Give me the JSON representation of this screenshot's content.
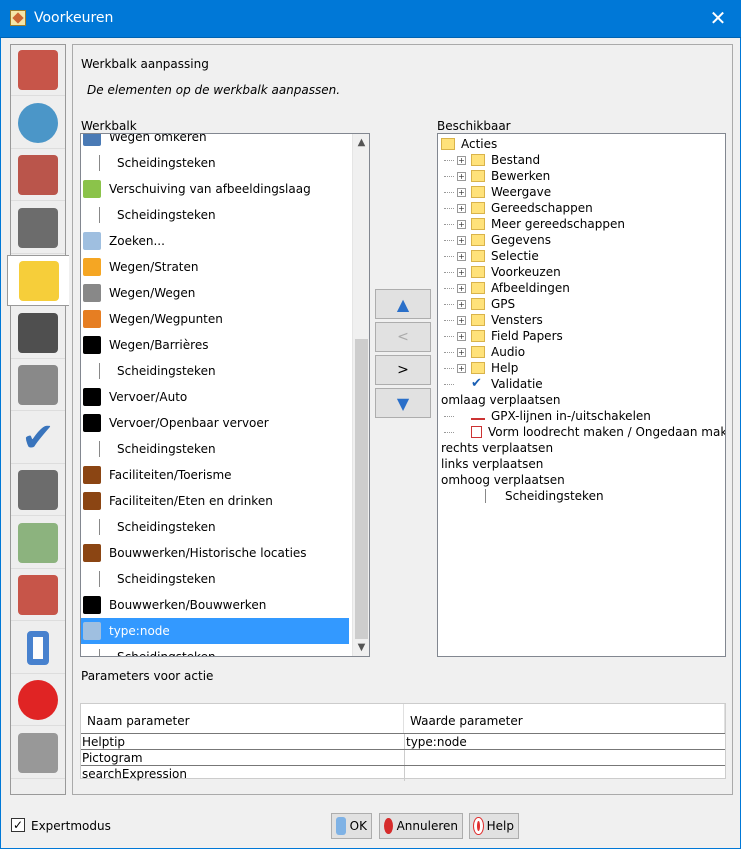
{
  "window": {
    "title": "Voorkeuren"
  },
  "section": {
    "title": "Werkbalk aanpassing",
    "description": "De elementen op de werkbalk aanpassen.",
    "toolbar_label": "Werkbalk",
    "available_label": "Beschikbaar",
    "params_label": "Parameters voor actie"
  },
  "toolbar_items": [
    {
      "label": "Wegen omkeren",
      "icon": "reverse-ways-icon",
      "sep": false
    },
    {
      "label": "Scheidingsteken",
      "icon": "separator-icon",
      "sep": true
    },
    {
      "label": "Verschuiving van afbeeldingslaag",
      "icon": "imagery-offset-icon",
      "sep": false
    },
    {
      "label": "Scheidingsteken",
      "icon": "separator-icon",
      "sep": true
    },
    {
      "label": "Zoeken...",
      "icon": "search-icon",
      "sep": false
    },
    {
      "label": "Wegen/Straten",
      "icon": "street-icon",
      "sep": false
    },
    {
      "label": "Wegen/Wegen",
      "icon": "road-icon",
      "sep": false
    },
    {
      "label": "Wegen/Wegpunten",
      "icon": "waypoints-icon",
      "sep": false
    },
    {
      "label": "Wegen/Barrières",
      "icon": "barrier-hand-icon",
      "sep": false
    },
    {
      "label": "Scheidingsteken",
      "icon": "separator-icon",
      "sep": true
    },
    {
      "label": "Vervoer/Auto",
      "icon": "car-icon",
      "sep": false
    },
    {
      "label": "Vervoer/Openbaar vervoer",
      "icon": "bus-icon",
      "sep": false
    },
    {
      "label": "Scheidingsteken",
      "icon": "separator-icon",
      "sep": true
    },
    {
      "label": "Faciliteiten/Toerisme",
      "icon": "tourism-icon",
      "sep": false
    },
    {
      "label": "Faciliteiten/Eten en drinken",
      "icon": "food-icon",
      "sep": false
    },
    {
      "label": "Scheidingsteken",
      "icon": "separator-icon",
      "sep": true
    },
    {
      "label": "Bouwwerken/Historische locaties",
      "icon": "castle-icon",
      "sep": false
    },
    {
      "label": "Scheidingsteken",
      "icon": "separator-icon",
      "sep": true
    },
    {
      "label": "Bouwwerken/Bouwwerken",
      "icon": "factory-icon",
      "sep": false
    },
    {
      "label": "type:node",
      "icon": "search-icon",
      "sep": false,
      "selected": true
    },
    {
      "label": "Scheidingsteken",
      "icon": "separator-icon",
      "sep": true
    }
  ],
  "available_tree": [
    {
      "label": "Acties",
      "level": 0,
      "folder": true,
      "expander": false
    },
    {
      "label": "Bestand",
      "level": 1,
      "folder": true,
      "expander": true
    },
    {
      "label": "Bewerken",
      "level": 1,
      "folder": true,
      "expander": true
    },
    {
      "label": "Weergave",
      "level": 1,
      "folder": true,
      "expander": true
    },
    {
      "label": "Gereedschappen",
      "level": 1,
      "folder": true,
      "expander": true
    },
    {
      "label": "Meer gereedschappen",
      "level": 1,
      "folder": true,
      "expander": true
    },
    {
      "label": "Gegevens",
      "level": 1,
      "folder": true,
      "expander": true
    },
    {
      "label": "Selectie",
      "level": 1,
      "folder": true,
      "expander": true
    },
    {
      "label": "Voorkeuzen",
      "level": 1,
      "folder": true,
      "expander": true
    },
    {
      "label": "Afbeeldingen",
      "level": 1,
      "folder": true,
      "expander": true
    },
    {
      "label": "GPS",
      "level": 1,
      "folder": true,
      "expander": true
    },
    {
      "label": "Vensters",
      "level": 1,
      "folder": true,
      "expander": true
    },
    {
      "label": "Field Papers",
      "level": 1,
      "folder": true,
      "expander": true
    },
    {
      "label": "Audio",
      "level": 1,
      "folder": true,
      "expander": true
    },
    {
      "label": "Help",
      "level": 1,
      "folder": true,
      "expander": true
    },
    {
      "label": "Validatie",
      "level": 1,
      "folder": false,
      "expander": false,
      "icon": "checkmark-icon"
    },
    {
      "label": "omlaag verplaatsen",
      "level": 0,
      "folder": false,
      "expander": false
    },
    {
      "label": "GPX-lijnen in-/uitschakelen",
      "level": 1,
      "folder": false,
      "expander": false,
      "icon": "gpx-icon"
    },
    {
      "label": "Vorm loodrecht maken / Ongedaan maken",
      "level": 1,
      "folder": false,
      "expander": false,
      "icon": "orthogonal-icon"
    },
    {
      "label": "rechts verplaatsen",
      "level": 0,
      "folder": false,
      "expander": false
    },
    {
      "label": "links verplaatsen",
      "level": 0,
      "folder": false,
      "expander": false
    },
    {
      "label": "omhoog verplaatsen",
      "level": 0,
      "folder": false,
      "expander": false
    },
    {
      "label": "Scheidingsteken",
      "level": 2,
      "folder": false,
      "expander": false,
      "icon": "separator-icon"
    }
  ],
  "move_buttons": {
    "up": "▲",
    "left": "<",
    "right": ">",
    "down": "▼"
  },
  "params": {
    "col_name": "Naam parameter",
    "col_value": "Waarde parameter",
    "rows": [
      {
        "name": "Helptip",
        "value": "type:node"
      },
      {
        "name": "Pictogram",
        "value": ""
      },
      {
        "name": "searchExpression",
        "value": ""
      }
    ]
  },
  "footer": {
    "expert_mode": "Expertmodus",
    "expert_checked": "✓",
    "ok": "OK",
    "cancel": "Annuleren",
    "help": "Help"
  },
  "sidebar_tabs": [
    "display-settings-icon",
    "map-settings-icon",
    "projection-icon",
    "connection-icon",
    "toolbar-icon",
    "audio-icon",
    "keyboard-icon",
    "validator-icon",
    "remote-control-icon",
    "imagery-icon",
    "plugins-icon",
    "map-paint-icon",
    "restriction-icon",
    "map-document-icon"
  ]
}
